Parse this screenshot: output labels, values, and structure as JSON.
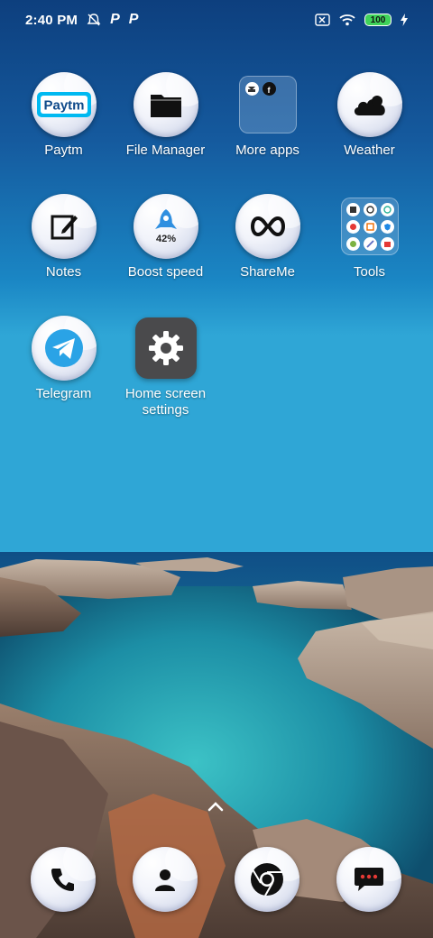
{
  "status_bar": {
    "time": "2:40 PM",
    "battery": "100",
    "icons": [
      "alarm-off-icon",
      "paytm-p-icon",
      "paytm-p-icon",
      "sim-disabled-icon",
      "wifi-icon",
      "battery-icon",
      "charging-bolt-icon"
    ]
  },
  "apps": [
    {
      "label": "Paytm",
      "icon": "paytm-icon"
    },
    {
      "label": "File Manager",
      "icon": "folder-icon"
    },
    {
      "label": "More apps",
      "icon": "more-apps-folder"
    },
    {
      "label": "Weather",
      "icon": "cloud-icon"
    },
    {
      "label": "Notes",
      "icon": "note-edit-icon"
    },
    {
      "label": "Boost speed",
      "icon": "rocket-icon",
      "value": "42%"
    },
    {
      "label": "ShareMe",
      "icon": "infinity-icon"
    },
    {
      "label": "Tools",
      "icon": "tools-folder"
    },
    {
      "label": "Telegram",
      "icon": "telegram-icon"
    },
    {
      "label": "Home screen settings",
      "icon": "gear-icon"
    }
  ],
  "paytm_logo_text": "Paytm",
  "dock": [
    "phone-icon",
    "contacts-icon",
    "chrome-icon",
    "messages-icon"
  ],
  "colors": {
    "accent_blue": "#1d8fe8",
    "settings_bg": "#4a4a4c",
    "battery_green": "#3fd35a"
  }
}
